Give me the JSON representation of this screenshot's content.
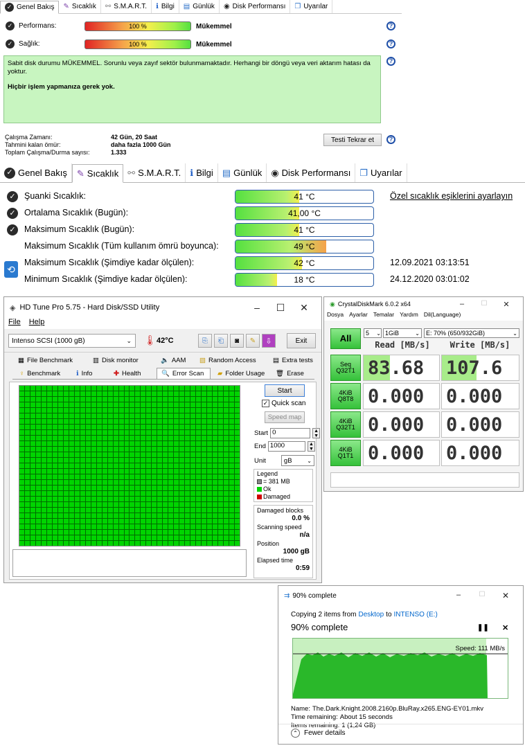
{
  "hds_top": {
    "tabs": [
      "Genel Bakış",
      "Sıcaklık",
      "S.M.A.R.T.",
      "Bilgi",
      "Günlük",
      "Disk Performansı",
      "Uyarılar"
    ],
    "performance_label": "Performans:",
    "performance_value": "100 %",
    "performance_text": "Mükemmel",
    "health_label": "Sağlık:",
    "health_value": "100 %",
    "health_text": "Mükemmel",
    "message": "Sabit disk durumu MÜKEMMEL. Sorunlu veya zayıf sektör bulunmamaktadır. Herhangi bir döngü veya veri aktarım hatası da yoktur.",
    "message_bold": "Hiçbir işlem yapmanıza gerek yok.",
    "uptime_label": "Çalışma Zamanı:",
    "uptime_value": "42 Gün, 20 Saat",
    "remaining_label": "Tahmini kalan ömür:",
    "remaining_value": "daha fazla 1000 Gün",
    "startstop_label": "Toplam Çalışma/Durma sayısı:",
    "startstop_value": "1.333",
    "retest_button": "Testi Tekrar et"
  },
  "hds_temp": {
    "tabs": [
      "Genel Bakış",
      "Sıcaklık",
      "S.M.A.R.T.",
      "Bilgi",
      "Günlük",
      "Disk Performansı",
      "Uyarılar"
    ],
    "rows": [
      {
        "label": "Şuanki Sıcaklık:",
        "value": "41 °C",
        "fill": 0.46,
        "extra": "Özel sıcaklık eşiklerini ayarlayın"
      },
      {
        "label": "Ortalama Sıcaklık (Bugün):",
        "value": "41,00 °C",
        "fill": 0.46,
        "extra": ""
      },
      {
        "label": "Maksimum Sıcaklık (Bugün):",
        "value": "41 °C",
        "fill": 0.46,
        "extra": ""
      },
      {
        "label": "Maksimum Sıcaklık (Tüm kullanım ömrü boyunca):",
        "value": "49 °C",
        "fill": 0.66,
        "extra": ""
      },
      {
        "label": "Maksimum Sıcaklık (Şimdiye kadar ölçülen):",
        "value": "42 °C",
        "fill": 0.48,
        "extra": "12.09.2021 03:13:51"
      },
      {
        "label": "Minimum Sıcaklık (Şimdiye kadar ölçülen):",
        "value": "18 °C",
        "fill": 0.3,
        "extra": "24.12.2020 03:01:02"
      }
    ]
  },
  "hdtune": {
    "title": "HD Tune Pro 5.75 - Hard Disk/SSD Utility",
    "menu": [
      "File",
      "Help"
    ],
    "drive": "Intenso SCSI (1000 gB)",
    "temp": "42°C",
    "exit": "Exit",
    "tabs_row1": [
      "File Benchmark",
      "Disk monitor",
      "AAM",
      "Random Access",
      "Extra tests"
    ],
    "tabs_row2": [
      "Benchmark",
      "Info",
      "Health",
      "Error Scan",
      "Folder Usage",
      "Erase"
    ],
    "start": "Start",
    "quick_scan": "Quick scan",
    "speed_map": "Speed map",
    "start_label": "Start",
    "start_value": "0",
    "end_label": "End",
    "end_value": "1000",
    "unit_label": "Unit",
    "unit_value": "gB",
    "legend_title": "Legend",
    "legend_block": "= 381 MB",
    "legend_ok": "Ok",
    "legend_damaged": "Damaged",
    "damaged_label": "Damaged blocks",
    "damaged_value": "0.0 %",
    "speed_label": "Scanning speed",
    "speed_value": "n/a",
    "position_label": "Position",
    "position_value": "1000 gB",
    "elapsed_label": "Elapsed time",
    "elapsed_value": "0:59"
  },
  "cdm": {
    "title": "CrystalDiskMark 6.0.2 x64",
    "menu": [
      "Dosya",
      "Ayarlar",
      "Temalar",
      "Yardım",
      "Dil(Language)"
    ],
    "all": "All",
    "count": "5",
    "size": "1GiB",
    "drive": "E: 70% (650/932GiB)",
    "read_header": "Read [MB/s]",
    "write_header": "Write [MB/s]",
    "rows": [
      {
        "l1": "Seq",
        "l2": "Q32T1",
        "read": "83.68",
        "write": "107.6",
        "rfill": 0.35,
        "wfill": 0.45
      },
      {
        "l1": "4KiB",
        "l2": "Q8T8",
        "read": "0.000",
        "write": "0.000",
        "rfill": 0,
        "wfill": 0
      },
      {
        "l1": "4KiB",
        "l2": "Q32T1",
        "read": "0.000",
        "write": "0.000",
        "rfill": 0,
        "wfill": 0
      },
      {
        "l1": "4KiB",
        "l2": "Q1T1",
        "read": "0.000",
        "write": "0.000",
        "rfill": 0,
        "wfill": 0
      }
    ]
  },
  "copy": {
    "title": "90% complete",
    "copying_prefix": "Copying 2 items from",
    "from": "Desktop",
    "to_word": "to",
    "to": "INTENSO (E:)",
    "heading": "90% complete",
    "speed": "Speed: 111 MB/s",
    "progress": 0.9,
    "name_label": "Name:",
    "name_value": "The.Dark.Knight.2008.2160p.BluRay.x265.ENG-EY01.mkv",
    "time_label": "Time remaining:",
    "time_value": "About 15 seconds",
    "items_label": "Items remaining:",
    "items_value": "1 (1,24 GB)",
    "fewer": "Fewer details"
  },
  "colors": {
    "green": "#00d400",
    "accent": "#0078d7",
    "cdm_green": "#35c13a"
  }
}
